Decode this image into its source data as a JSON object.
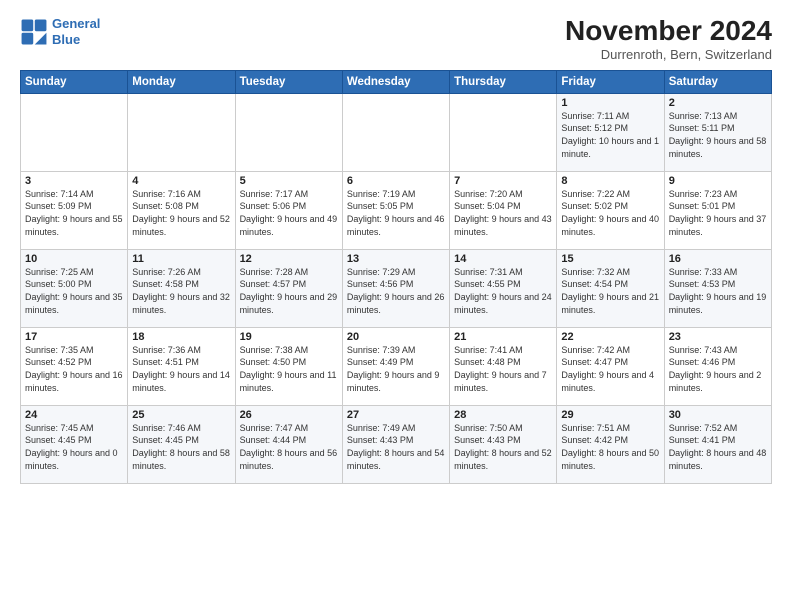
{
  "logo": {
    "line1": "General",
    "line2": "Blue"
  },
  "title": "November 2024",
  "subtitle": "Durrenroth, Bern, Switzerland",
  "days_of_week": [
    "Sunday",
    "Monday",
    "Tuesday",
    "Wednesday",
    "Thursday",
    "Friday",
    "Saturday"
  ],
  "weeks": [
    [
      {
        "day": "",
        "info": ""
      },
      {
        "day": "",
        "info": ""
      },
      {
        "day": "",
        "info": ""
      },
      {
        "day": "",
        "info": ""
      },
      {
        "day": "",
        "info": ""
      },
      {
        "day": "1",
        "info": "Sunrise: 7:11 AM\nSunset: 5:12 PM\nDaylight: 10 hours and 1 minute."
      },
      {
        "day": "2",
        "info": "Sunrise: 7:13 AM\nSunset: 5:11 PM\nDaylight: 9 hours and 58 minutes."
      }
    ],
    [
      {
        "day": "3",
        "info": "Sunrise: 7:14 AM\nSunset: 5:09 PM\nDaylight: 9 hours and 55 minutes."
      },
      {
        "day": "4",
        "info": "Sunrise: 7:16 AM\nSunset: 5:08 PM\nDaylight: 9 hours and 52 minutes."
      },
      {
        "day": "5",
        "info": "Sunrise: 7:17 AM\nSunset: 5:06 PM\nDaylight: 9 hours and 49 minutes."
      },
      {
        "day": "6",
        "info": "Sunrise: 7:19 AM\nSunset: 5:05 PM\nDaylight: 9 hours and 46 minutes."
      },
      {
        "day": "7",
        "info": "Sunrise: 7:20 AM\nSunset: 5:04 PM\nDaylight: 9 hours and 43 minutes."
      },
      {
        "day": "8",
        "info": "Sunrise: 7:22 AM\nSunset: 5:02 PM\nDaylight: 9 hours and 40 minutes."
      },
      {
        "day": "9",
        "info": "Sunrise: 7:23 AM\nSunset: 5:01 PM\nDaylight: 9 hours and 37 minutes."
      }
    ],
    [
      {
        "day": "10",
        "info": "Sunrise: 7:25 AM\nSunset: 5:00 PM\nDaylight: 9 hours and 35 minutes."
      },
      {
        "day": "11",
        "info": "Sunrise: 7:26 AM\nSunset: 4:58 PM\nDaylight: 9 hours and 32 minutes."
      },
      {
        "day": "12",
        "info": "Sunrise: 7:28 AM\nSunset: 4:57 PM\nDaylight: 9 hours and 29 minutes."
      },
      {
        "day": "13",
        "info": "Sunrise: 7:29 AM\nSunset: 4:56 PM\nDaylight: 9 hours and 26 minutes."
      },
      {
        "day": "14",
        "info": "Sunrise: 7:31 AM\nSunset: 4:55 PM\nDaylight: 9 hours and 24 minutes."
      },
      {
        "day": "15",
        "info": "Sunrise: 7:32 AM\nSunset: 4:54 PM\nDaylight: 9 hours and 21 minutes."
      },
      {
        "day": "16",
        "info": "Sunrise: 7:33 AM\nSunset: 4:53 PM\nDaylight: 9 hours and 19 minutes."
      }
    ],
    [
      {
        "day": "17",
        "info": "Sunrise: 7:35 AM\nSunset: 4:52 PM\nDaylight: 9 hours and 16 minutes."
      },
      {
        "day": "18",
        "info": "Sunrise: 7:36 AM\nSunset: 4:51 PM\nDaylight: 9 hours and 14 minutes."
      },
      {
        "day": "19",
        "info": "Sunrise: 7:38 AM\nSunset: 4:50 PM\nDaylight: 9 hours and 11 minutes."
      },
      {
        "day": "20",
        "info": "Sunrise: 7:39 AM\nSunset: 4:49 PM\nDaylight: 9 hours and 9 minutes."
      },
      {
        "day": "21",
        "info": "Sunrise: 7:41 AM\nSunset: 4:48 PM\nDaylight: 9 hours and 7 minutes."
      },
      {
        "day": "22",
        "info": "Sunrise: 7:42 AM\nSunset: 4:47 PM\nDaylight: 9 hours and 4 minutes."
      },
      {
        "day": "23",
        "info": "Sunrise: 7:43 AM\nSunset: 4:46 PM\nDaylight: 9 hours and 2 minutes."
      }
    ],
    [
      {
        "day": "24",
        "info": "Sunrise: 7:45 AM\nSunset: 4:45 PM\nDaylight: 9 hours and 0 minutes."
      },
      {
        "day": "25",
        "info": "Sunrise: 7:46 AM\nSunset: 4:45 PM\nDaylight: 8 hours and 58 minutes."
      },
      {
        "day": "26",
        "info": "Sunrise: 7:47 AM\nSunset: 4:44 PM\nDaylight: 8 hours and 56 minutes."
      },
      {
        "day": "27",
        "info": "Sunrise: 7:49 AM\nSunset: 4:43 PM\nDaylight: 8 hours and 54 minutes."
      },
      {
        "day": "28",
        "info": "Sunrise: 7:50 AM\nSunset: 4:43 PM\nDaylight: 8 hours and 52 minutes."
      },
      {
        "day": "29",
        "info": "Sunrise: 7:51 AM\nSunset: 4:42 PM\nDaylight: 8 hours and 50 minutes."
      },
      {
        "day": "30",
        "info": "Sunrise: 7:52 AM\nSunset: 4:41 PM\nDaylight: 8 hours and 48 minutes."
      }
    ]
  ]
}
